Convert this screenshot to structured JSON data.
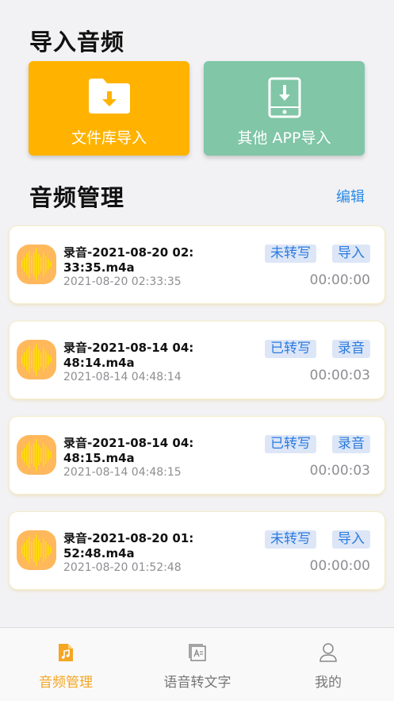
{
  "import_section": {
    "title": "导入音频",
    "cards": [
      {
        "label": "文件库导入",
        "icon": "folder-download-icon",
        "color": "#ffb300"
      },
      {
        "label": "其他 APP导入",
        "icon": "phone-download-icon",
        "color": "#80c6a7"
      }
    ]
  },
  "manage_section": {
    "title": "音频管理",
    "edit_label": "编辑"
  },
  "recordings": [
    {
      "name": "录音-2021-08-20 02:33:35.m4a",
      "date": "2021-08-20 02:33:35",
      "status": "未转写",
      "source": "导入",
      "duration": "00:00:00"
    },
    {
      "name": "录音-2021-08-14 04:48:14.m4a",
      "date": "2021-08-14 04:48:14",
      "status": "已转写",
      "source": "录音",
      "duration": "00:00:03"
    },
    {
      "name": "录音-2021-08-14 04:48:15.m4a",
      "date": "2021-08-14 04:48:15",
      "status": "已转写",
      "source": "录音",
      "duration": "00:00:03"
    },
    {
      "name": "录音-2021-08-20 01:52:48.m4a",
      "date": "2021-08-20 01:52:48",
      "status": "未转写",
      "source": "导入",
      "duration": "00:00:00"
    }
  ],
  "tabbar": {
    "tabs": [
      {
        "label": "音频管理",
        "icon": "music-file-icon",
        "active": true
      },
      {
        "label": "语音转文字",
        "icon": "text-convert-icon",
        "active": false
      },
      {
        "label": "我的",
        "icon": "user-icon",
        "active": false
      }
    ],
    "active_color": "#f5a623"
  },
  "colors": {
    "accent_blue": "#2a8ae8",
    "waveform_bg": "#ffb85c",
    "waveform_bar": "#ffe000"
  }
}
